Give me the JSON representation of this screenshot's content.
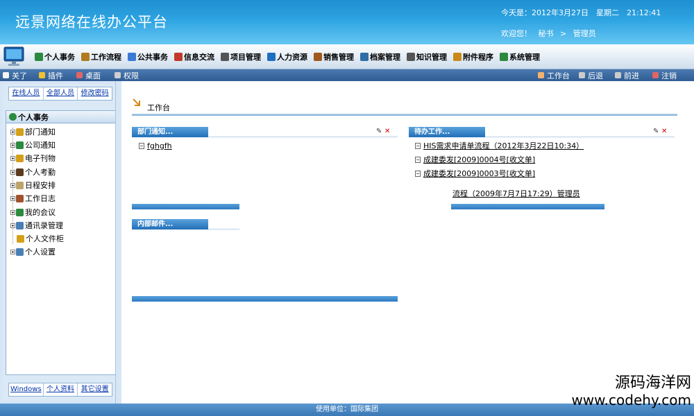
{
  "header": {
    "app_title": "远景网络在线办公平台",
    "date_text": "今天是：2012年3月27日　星期二　21:12:41",
    "welcome": "欢迎您！",
    "role": "秘书",
    "separator": ">",
    "user": "管理员"
  },
  "menu": {
    "items": [
      {
        "label": "个人事务",
        "icon": "person-icon",
        "color": "#2b8a3e"
      },
      {
        "label": "工作流程",
        "icon": "workflow-icon",
        "color": "#b07b1e"
      },
      {
        "label": "公共事务",
        "icon": "public-icon",
        "color": "#3a7ad5"
      },
      {
        "label": "信息交流",
        "icon": "message-icon",
        "color": "#c0392b"
      },
      {
        "label": "项目管理",
        "icon": "project-icon",
        "color": "#555555"
      },
      {
        "label": "人力资源",
        "icon": "people-icon",
        "color": "#1e6fbf"
      },
      {
        "label": "销售管理",
        "icon": "sales-icon",
        "color": "#a05a1e"
      },
      {
        "label": "档案管理",
        "icon": "archive-icon",
        "color": "#2e6da4"
      },
      {
        "label": "知识管理",
        "icon": "book-icon",
        "color": "#555555"
      },
      {
        "label": "附件程序",
        "icon": "attachment-icon",
        "color": "#c98a1a"
      },
      {
        "label": "系统管理",
        "icon": "system-icon",
        "color": "#2b8a3e"
      }
    ]
  },
  "toolbar": {
    "left": [
      {
        "label": "关了",
        "icon": "page-icon"
      },
      {
        "label": "插件",
        "icon": "plugin-icon"
      },
      {
        "label": "桌面",
        "icon": "desktop-icon"
      },
      {
        "label": "权限",
        "icon": "permission-icon"
      }
    ],
    "right": [
      {
        "label": "工作台",
        "icon": "home-icon"
      },
      {
        "label": "后退",
        "icon": "back-icon"
      },
      {
        "label": "前进",
        "icon": "forward-icon"
      },
      {
        "label": "注销",
        "icon": "logout-icon"
      }
    ]
  },
  "sidebar": {
    "top_tabs": [
      "在线人员",
      "全部人员",
      "修改密码"
    ],
    "tree_title": "个人事务",
    "tree_items": [
      {
        "label": "部门通知",
        "icon": "megaphone-icon",
        "color": "#d4a017",
        "expand": true
      },
      {
        "label": "公司通知",
        "icon": "star-icon",
        "color": "#2b8a3e",
        "expand": true
      },
      {
        "label": "电子刊物",
        "icon": "folder-icon",
        "color": "#d4a017",
        "expand": true
      },
      {
        "label": "个人考勤",
        "icon": "attendance-icon",
        "color": "#5a3a1e",
        "expand": true
      },
      {
        "label": "日程安排",
        "icon": "calendar-icon",
        "color": "#bda36a",
        "expand": true
      },
      {
        "label": "工作日志",
        "icon": "pencil-icon",
        "color": "#a0522d",
        "expand": true
      },
      {
        "label": "我的会议",
        "icon": "meeting-icon",
        "color": "#2b8a3e",
        "expand": true
      },
      {
        "label": "通讯录管理",
        "icon": "contacts-icon",
        "color": "#4a7fb5",
        "expand": true
      },
      {
        "label": "个人文件柜",
        "icon": "cabinet-icon",
        "color": "#d4a017",
        "expand": false
      },
      {
        "label": "个人设置",
        "icon": "settings-icon",
        "color": "#4a7fb5",
        "expand": true
      }
    ],
    "bottom_tabs": [
      "Windows",
      "个人资料",
      "其它设置"
    ]
  },
  "workspace": {
    "title": "工作台",
    "panels": {
      "dept_notice": {
        "title": "部门通知...",
        "items": [
          "fghgfh"
        ]
      },
      "todo": {
        "title": "待办工作...",
        "items": [
          "HIS需求申请单流程（2012年3月22日10:34）",
          "成建委发[2009]0004号[收文单]",
          "成建委发[2009]0003号[收文单]",
          "流程（2009年7月7日17:29）管理员"
        ]
      },
      "mail": {
        "title": "内部邮件..."
      }
    }
  },
  "footer": {
    "text": "使用单位：国际集团"
  },
  "watermark": {
    "line1": "源码海洋网",
    "line2": "www.codehy.com"
  }
}
